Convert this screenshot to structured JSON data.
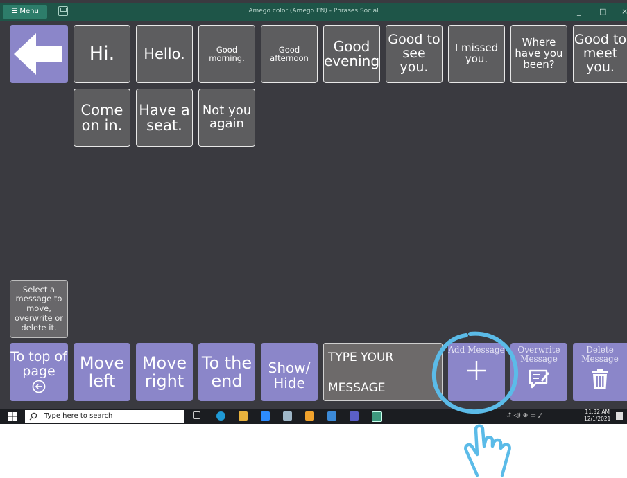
{
  "titlebar": {
    "menu_label": "☰ Menu",
    "window_title": "Amego color (Amego EN) - Phrases Social",
    "minimize": "_",
    "maximize": "□",
    "close": "×"
  },
  "phrases": [
    {
      "label": "Hi."
    },
    {
      "label": "Hello."
    },
    {
      "label": "Good morning."
    },
    {
      "label": "Good afternoon"
    },
    {
      "label": "Good evening"
    },
    {
      "label": "Good to see you."
    },
    {
      "label": "I missed you."
    },
    {
      "label": "Where have you been?"
    },
    {
      "label": "Good to meet you."
    },
    {
      "label": "Come on in."
    },
    {
      "label": "Have a seat."
    },
    {
      "label": "Not you again"
    }
  ],
  "hint": "Select a message to move, overwrite or delete it.",
  "controls": {
    "to_top": "To top of page",
    "move_left": "Move left",
    "move_right": "Move right",
    "to_end": "To the end",
    "show_hide": "Show/ Hide",
    "message_line1": "TYPE YOUR",
    "message_line2": "MESSAGE",
    "add_message": "Add Message",
    "overwrite_message": "Overwrite Message",
    "delete_message": "Delete Message"
  },
  "taskbar": {
    "search_placeholder": "Type here to search",
    "time": "11:32 AM",
    "date": "12/1/2021"
  },
  "colors": {
    "accent_purple": "#8b86c9",
    "titlebar_green": "#1e5548",
    "background": "#3a3a40",
    "highlight_ring": "#5bbbe8"
  }
}
